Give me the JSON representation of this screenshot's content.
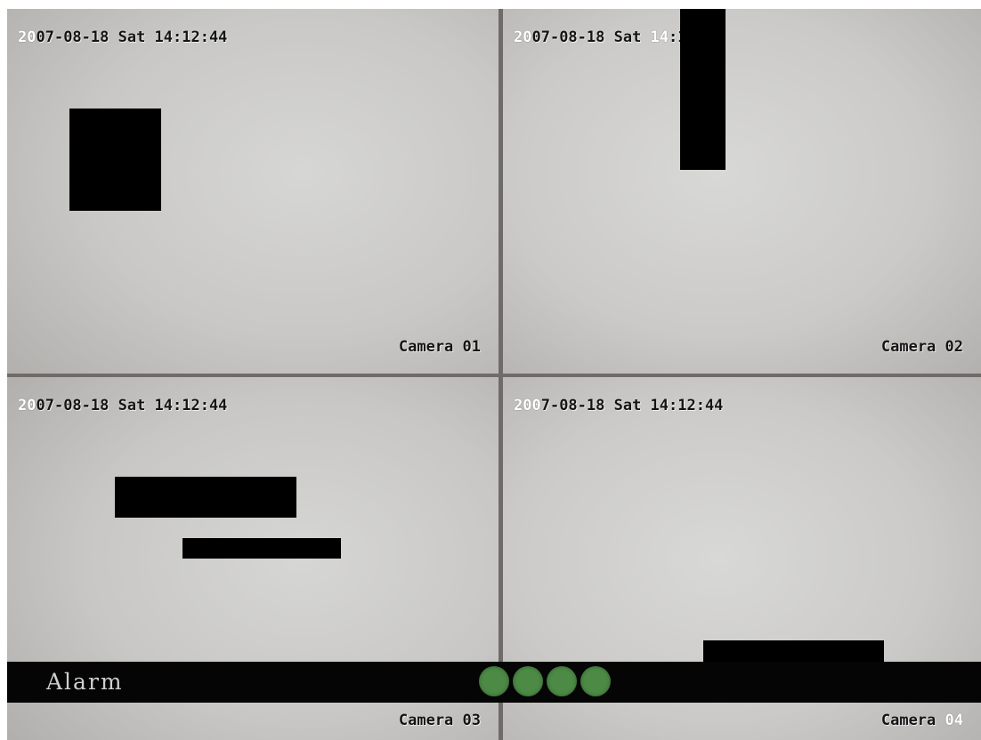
{
  "panes": [
    {
      "timestamp_prefix": "20",
      "timestamp_rest": "07-08-18 Sat 14:12:44",
      "camera_label": "Camera 01"
    },
    {
      "timestamp_prefix": "20",
      "timestamp_mid": "07-08-18 Sat ",
      "timestamp_hl": "14",
      "timestamp_rest": ":12:44",
      "camera_label": "Camera 02"
    },
    {
      "timestamp_prefix": "20",
      "timestamp_rest": "07-08-18 Sat 14:12:44",
      "camera_label": "Camera 03"
    },
    {
      "timestamp_prefix": "200",
      "timestamp_rest": "7-08-18 Sat 14:12:44",
      "camera_label_prefix": "Camera ",
      "camera_label_hl": "04"
    }
  ],
  "alarm_bar": {
    "label": "Alarm",
    "indicator_count": 4,
    "indicator_color": "#4c8a45"
  },
  "colors": {
    "osd_text": "#141414",
    "osd_highlight": "#ffffff",
    "privacy_mask": "#000000"
  }
}
